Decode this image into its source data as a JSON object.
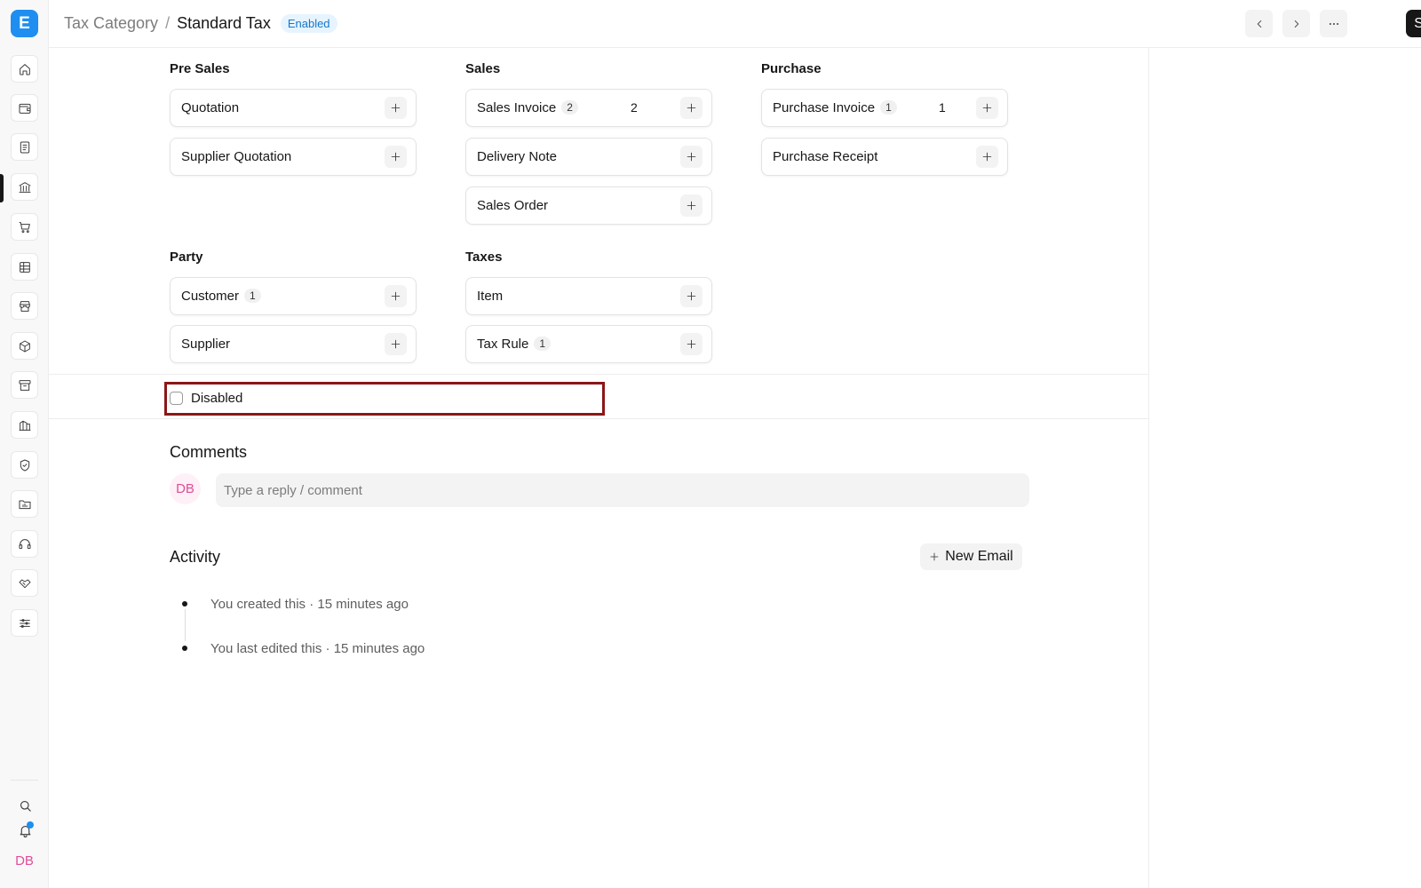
{
  "sidebar": {
    "logo_letter": "E",
    "nav_items": [
      {
        "icon": "home-icon"
      },
      {
        "icon": "wallet-icon"
      },
      {
        "icon": "document-icon"
      },
      {
        "icon": "bank-icon"
      },
      {
        "icon": "cart-icon"
      },
      {
        "icon": "table-icon"
      },
      {
        "icon": "store-icon"
      },
      {
        "icon": "package-icon"
      },
      {
        "icon": "archive-icon"
      },
      {
        "icon": "building-icon"
      },
      {
        "icon": "shield-icon"
      },
      {
        "icon": "folder-chart-icon"
      },
      {
        "icon": "headset-icon"
      },
      {
        "icon": "handshake-icon"
      },
      {
        "icon": "sliders-icon"
      }
    ],
    "active_item": "bank-icon",
    "bottom": {
      "search_icon": "search-icon",
      "notification_icon": "bell-icon",
      "avatar_initials": "DB"
    },
    "notification_dot_color": "#1f8ef1"
  },
  "header": {
    "breadcrumb_parent": "Tax Category",
    "breadcrumb_separator": "/",
    "title": "Standard Tax",
    "status_badge": "Enabled",
    "prev_icon": "chevron-left-icon",
    "next_icon": "chevron-right-icon",
    "more_icon": "more-horizontal-icon",
    "save_label": "Save"
  },
  "connections": {
    "pre_sales": {
      "title": "Pre Sales",
      "items": [
        {
          "label": "Quotation"
        },
        {
          "label": "Supplier Quotation"
        }
      ]
    },
    "sales": {
      "title": "Sales",
      "items": [
        {
          "label": "Sales Invoice",
          "count": "2",
          "open_count": "2"
        },
        {
          "label": "Delivery Note"
        },
        {
          "label": "Sales Order"
        }
      ]
    },
    "purchase": {
      "title": "Purchase",
      "items": [
        {
          "label": "Purchase Invoice",
          "count": "1",
          "open_count": "1"
        },
        {
          "label": "Purchase Receipt"
        }
      ]
    },
    "party": {
      "title": "Party",
      "items": [
        {
          "label": "Customer",
          "count": "1"
        },
        {
          "label": "Supplier"
        }
      ]
    },
    "taxes": {
      "title": "Taxes",
      "items": [
        {
          "label": "Item"
        },
        {
          "label": "Tax Rule",
          "count": "1"
        }
      ]
    }
  },
  "form": {
    "disabled_label": "Disabled",
    "disabled_checked": false
  },
  "comments": {
    "title": "Comments",
    "avatar_initials": "DB",
    "input_placeholder": "Type a reply / comment"
  },
  "activity": {
    "title": "Activity",
    "new_email_label": "New Email",
    "entries": [
      {
        "text": "You created this · 15 minutes ago"
      },
      {
        "text": "You last edited this · 15 minutes ago"
      }
    ]
  },
  "colors": {
    "accent": "#1f8ef1",
    "save_button_bg": "#171717",
    "badge_bg": "#e6f4ff",
    "badge_text": "#1677c9",
    "highlight_border": "#8b1717",
    "avatar_text": "#e24d98"
  }
}
